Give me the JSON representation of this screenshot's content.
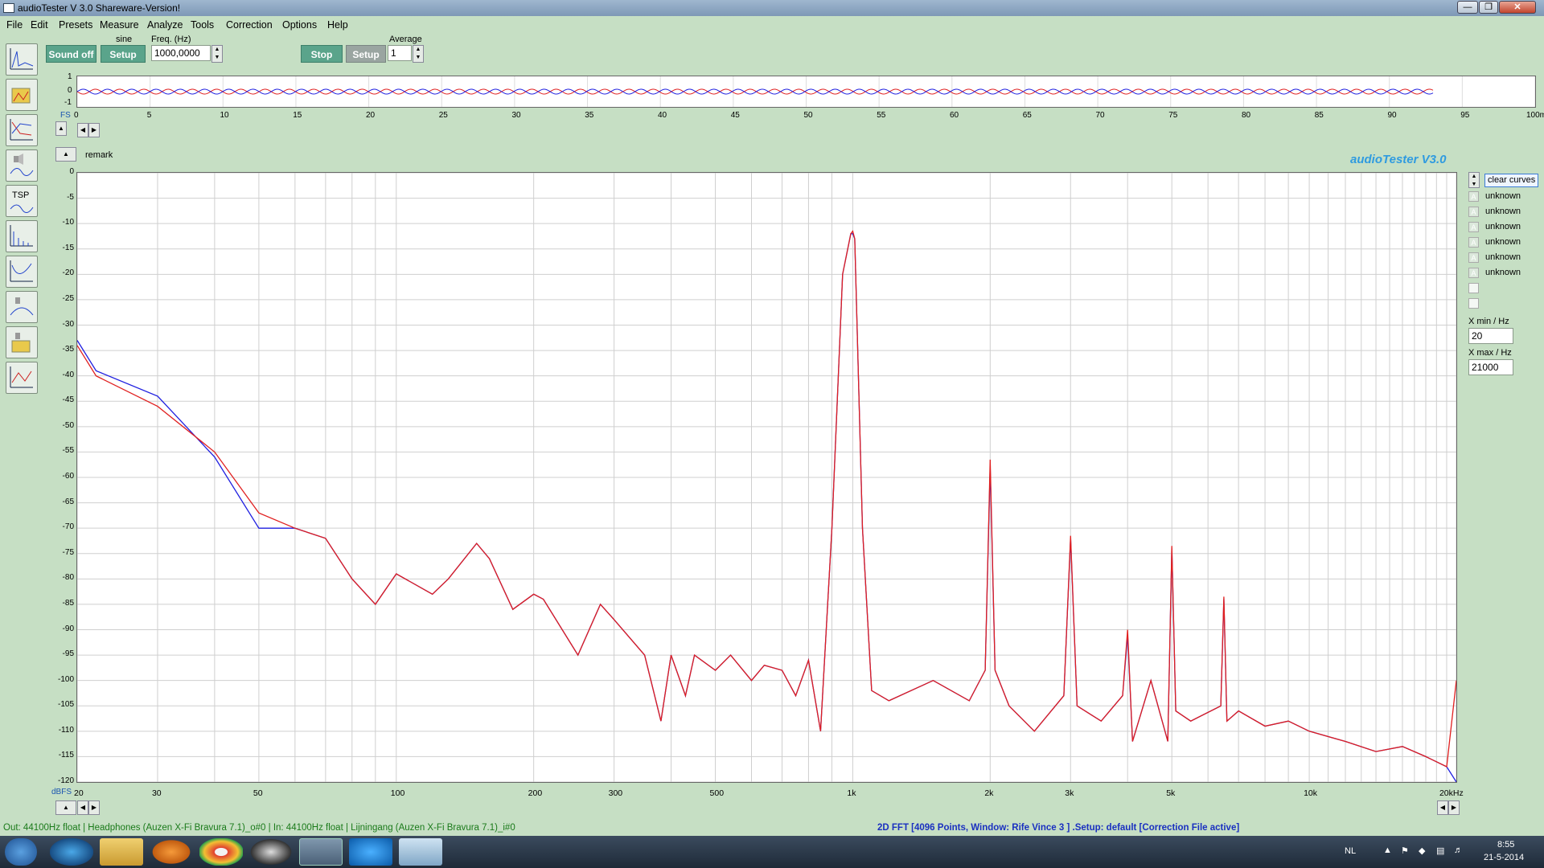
{
  "window": {
    "title": "audioTester  V 3.0 Shareware-Version!"
  },
  "menu": [
    "File",
    "Edit",
    "Presets",
    "Measure",
    "Analyze",
    "Tools",
    "Correction",
    "Options",
    "Help"
  ],
  "generator": {
    "waveform_label": "sine",
    "sound_off_label": "Sound off",
    "setup_label": "Setup",
    "freq_label": "Freq. (Hz)",
    "freq_value": "1000,0000"
  },
  "analyzer": {
    "stop_label": "Stop",
    "setup_label": "Setup",
    "average_label": "Average",
    "average_value": "1"
  },
  "scope": {
    "y_ticks": [
      "1",
      "0",
      "-1"
    ],
    "fs_label": "FS",
    "x_ticks": [
      "0",
      "5",
      "10",
      "15",
      "20",
      "25",
      "30",
      "35",
      "40",
      "45",
      "50",
      "55",
      "60",
      "65",
      "70",
      "75",
      "80",
      "85",
      "90",
      "95",
      "100ms"
    ]
  },
  "fft": {
    "remark_label": "remark",
    "brand": "audioTester  V3.0",
    "y_unit": "dBFS",
    "y_ticks": [
      "0",
      "-5",
      "-10",
      "-15",
      "-20",
      "-25",
      "-30",
      "-35",
      "-40",
      "-45",
      "-50",
      "-55",
      "-60",
      "-65",
      "-70",
      "-75",
      "-80",
      "-85",
      "-90",
      "-95",
      "-100",
      "-105",
      "-110",
      "-115",
      "-120"
    ],
    "x_ticks": [
      "20",
      "30",
      "50",
      "100",
      "200",
      "300",
      "500",
      "1k",
      "2k",
      "3k",
      "5k",
      "10k",
      "20kHz"
    ]
  },
  "legend": {
    "clear_label": "clear curves",
    "items": [
      "unknown",
      "unknown",
      "unknown",
      "unknown",
      "unknown",
      "unknown"
    ],
    "xmin_label": "X min / Hz",
    "xmin_value": "20",
    "xmax_label": "X max / Hz",
    "xmax_value": "21000"
  },
  "status": {
    "left": "Out: 44100Hz float  | Headphones (Auzen X-Fi Bravura 7.1)_o#0  | In: 44100Hz float  | Lijningang (Auzen X-Fi Bravura 7.1)_i#0",
    "right": "2D FFT [4096 Points, Window: Rife Vince 3 ]  .Setup:  default  [Correction File active]"
  },
  "taskbar": {
    "lang": "NL",
    "time": "8:55",
    "date": "21-5-2014"
  },
  "chart_data": {
    "type": "line",
    "xlabel": "",
    "ylabel": "dBFS",
    "x_scale": "log",
    "xlim": [
      20,
      21000
    ],
    "ylim": [
      -120,
      0
    ],
    "grid": true,
    "series": [
      {
        "color": "#1f1fe0",
        "x": [
          20,
          22,
          30,
          40,
          50,
          60,
          70,
          80,
          90,
          100,
          120,
          130,
          150,
          160,
          180,
          200,
          210,
          250,
          280,
          300,
          350,
          380,
          400,
          430,
          450,
          500,
          540,
          600,
          640,
          700,
          750,
          800,
          850,
          900,
          950,
          990,
          1000,
          1010,
          1050,
          1100,
          1200,
          1500,
          1800,
          1950,
          2000,
          2050,
          2200,
          2500,
          2900,
          3000,
          3100,
          3500,
          3900,
          4000,
          4100,
          4500,
          4900,
          5000,
          5100,
          5500,
          6400,
          6500,
          6600,
          7000,
          8000,
          9000,
          10000,
          12000,
          14000,
          16000,
          18000,
          20000,
          21000
        ],
        "y": [
          -33,
          -39,
          -44,
          -56,
          -70,
          -70,
          -72,
          -80,
          -85,
          -79,
          -83,
          -80,
          -73,
          -76,
          -86,
          -83,
          -84,
          -95,
          -85,
          -88,
          -95,
          -108,
          -95,
          -103,
          -95,
          -98,
          -95,
          -100,
          -97,
          -98,
          -103,
          -96,
          -110,
          -70,
          -20,
          -12,
          -12,
          -13,
          -70,
          -102,
          -104,
          -100,
          -104,
          -98,
          -58,
          -98,
          -105,
          -110,
          -103,
          -72,
          -105,
          -108,
          -103,
          -91,
          -112,
          -100,
          -112,
          -74,
          -106,
          -108,
          -105,
          -84,
          -108,
          -106,
          -109,
          -108,
          -110,
          -112,
          -114,
          -113,
          -115,
          -117,
          -120
        ]
      },
      {
        "color": "#e01f1f",
        "x": [
          20,
          22,
          30,
          40,
          50,
          60,
          70,
          80,
          90,
          100,
          120,
          130,
          150,
          160,
          180,
          200,
          210,
          250,
          280,
          300,
          350,
          380,
          400,
          430,
          450,
          500,
          540,
          600,
          640,
          700,
          750,
          800,
          850,
          900,
          950,
          990,
          1000,
          1010,
          1050,
          1100,
          1200,
          1500,
          1800,
          1950,
          2000,
          2050,
          2200,
          2500,
          2900,
          3000,
          3100,
          3500,
          3900,
          4000,
          4100,
          4500,
          4900,
          5000,
          5100,
          5500,
          6400,
          6500,
          6600,
          7000,
          8000,
          9000,
          10000,
          12000,
          14000,
          16000,
          18000,
          20000,
          21000
        ],
        "y": [
          -34,
          -40,
          -46,
          -55,
          -67,
          -70,
          -72,
          -80,
          -85,
          -79,
          -83,
          -80,
          -73,
          -76,
          -86,
          -83,
          -84,
          -95,
          -85,
          -88,
          -95,
          -108,
          -95,
          -103,
          -95,
          -98,
          -95,
          -100,
          -97,
          -98,
          -103,
          -96,
          -110,
          -70,
          -20,
          -12,
          -11.5,
          -13,
          -70,
          -102,
          -104,
          -100,
          -104,
          -98,
          -56.5,
          -98,
          -105,
          -110,
          -103,
          -71.5,
          -105,
          -108,
          -103,
          -90,
          -112,
          -100,
          -112,
          -73.5,
          -106,
          -108,
          -105,
          -83.5,
          -108,
          -106,
          -109,
          -108,
          -110,
          -112,
          -114,
          -113,
          -115,
          -117,
          -100
        ]
      }
    ]
  }
}
